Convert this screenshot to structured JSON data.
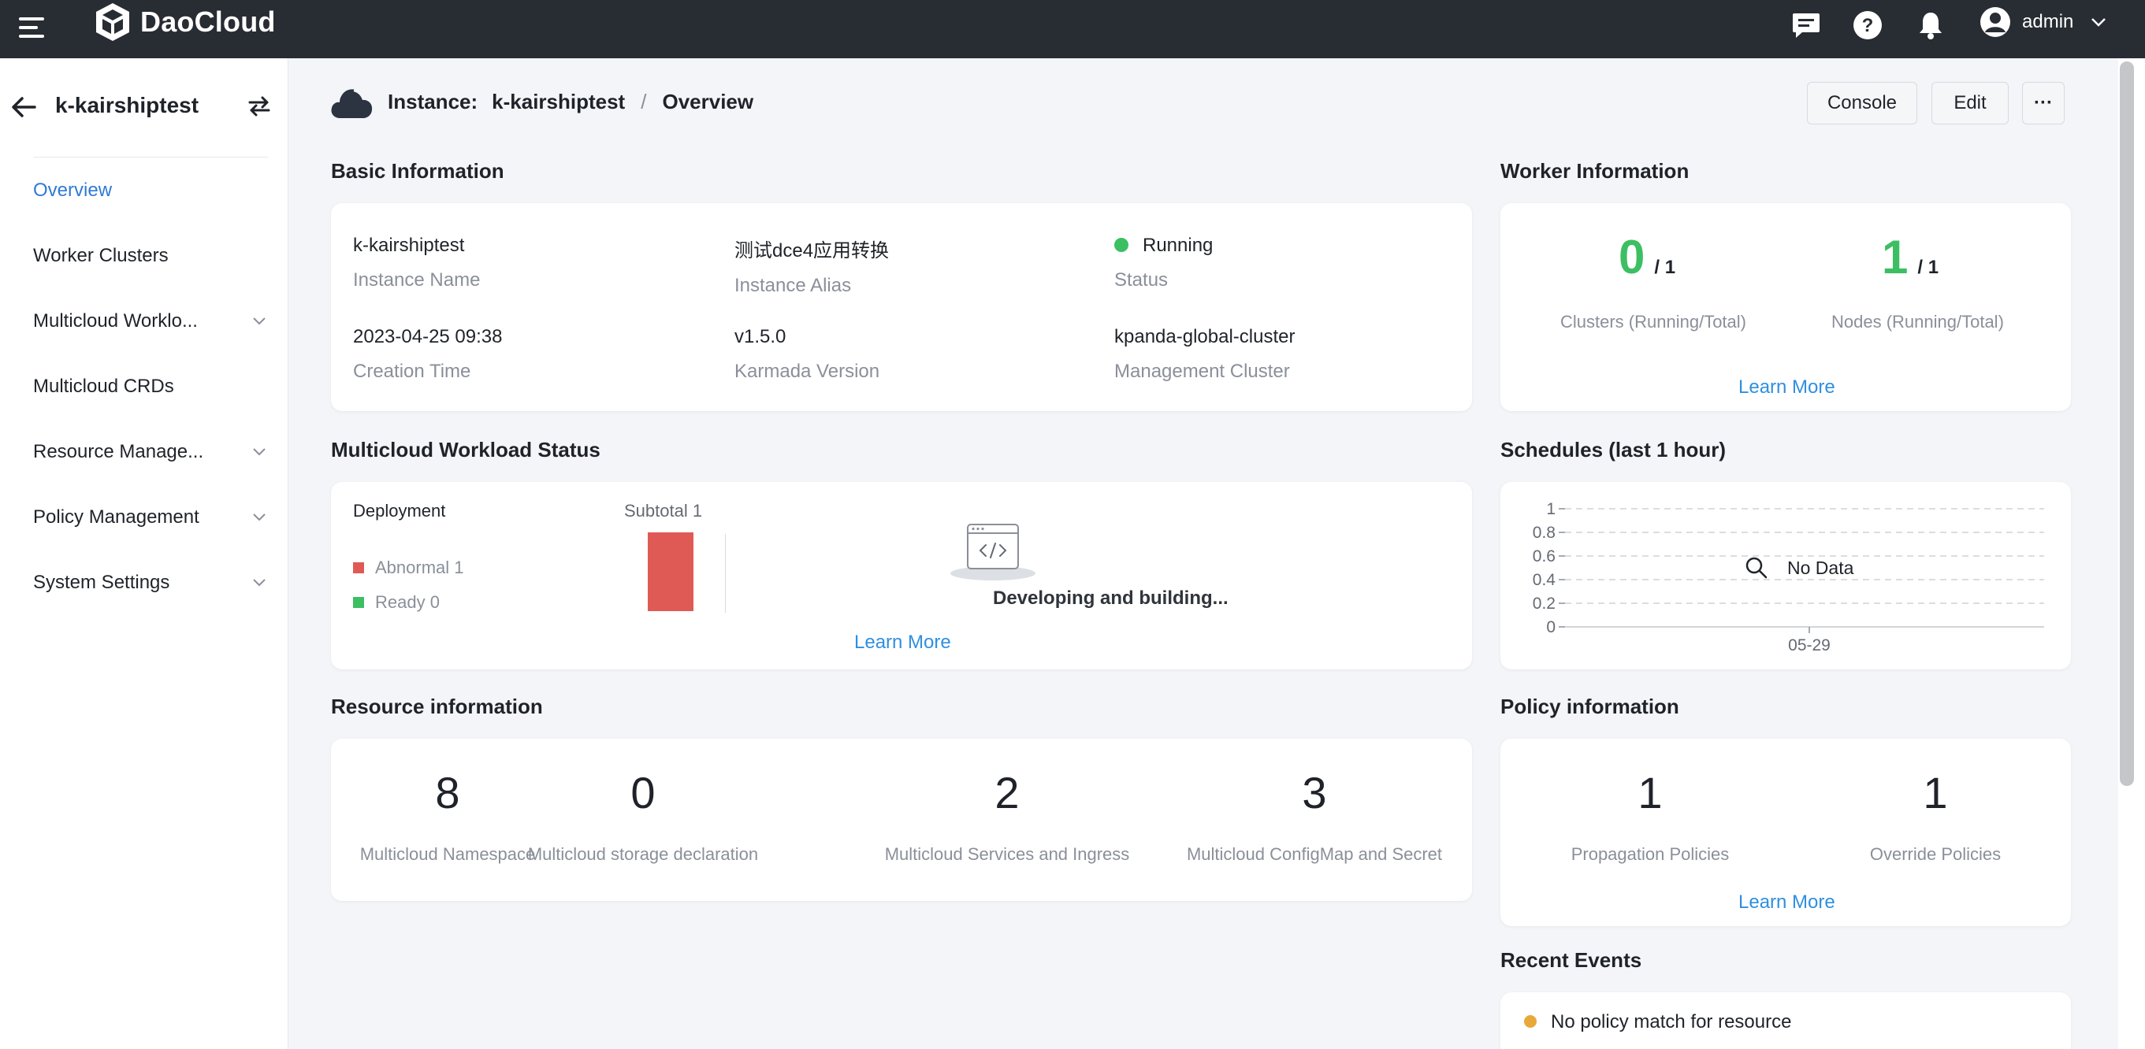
{
  "topbar": {
    "brand": "DaoCloud",
    "user": "admin"
  },
  "sidebar": {
    "title": "k-kairshiptest",
    "items": [
      {
        "label": "Overview",
        "active": true,
        "expandable": false
      },
      {
        "label": "Worker Clusters",
        "active": false,
        "expandable": false
      },
      {
        "label": "Multicloud Worklo...",
        "active": false,
        "expandable": true
      },
      {
        "label": "Multicloud CRDs",
        "active": false,
        "expandable": false
      },
      {
        "label": "Resource Manage...",
        "active": false,
        "expandable": true
      },
      {
        "label": "Policy Management",
        "active": false,
        "expandable": true
      },
      {
        "label": "System Settings",
        "active": false,
        "expandable": true
      }
    ]
  },
  "header": {
    "crumb_label": "Instance:",
    "crumb_name": "k-kairshiptest",
    "crumb_sep": "/",
    "crumb_current": "Overview",
    "buttons": {
      "console": "Console",
      "edit": "Edit",
      "more": "···"
    }
  },
  "basic_info": {
    "title": "Basic Information",
    "instance_name": {
      "value": "k-kairshiptest",
      "label": "Instance Name"
    },
    "instance_alias": {
      "value": "测试dce4应用转换",
      "label": "Instance Alias"
    },
    "status": {
      "value": "Running",
      "label": "Status",
      "color": "#3cbf62"
    },
    "creation_time": {
      "value": "2023-04-25 09:38",
      "label": "Creation Time"
    },
    "karmada_version": {
      "value": "v1.5.0",
      "label": "Karmada Version"
    },
    "management_cluster": {
      "value": "kpanda-global-cluster",
      "label": "Management Cluster"
    }
  },
  "worker_info": {
    "title": "Worker Information",
    "clusters": {
      "running": "0",
      "total": "/ 1",
      "label": "Clusters (Running/Total)"
    },
    "nodes": {
      "running": "1",
      "total": "/ 1",
      "label": "Nodes (Running/Total)"
    },
    "learn_more": "Learn More"
  },
  "workload_status": {
    "title": "Multicloud Workload Status",
    "kind": "Deployment",
    "subtotal": "Subtotal 1",
    "abnormal": {
      "label": "Abnormal 1",
      "value": 1,
      "color": "#e05a55"
    },
    "ready": {
      "label": "Ready 0",
      "value": 0,
      "color": "#3cbf62"
    },
    "placeholder": "Developing and building...",
    "learn_more": "Learn More"
  },
  "schedules": {
    "title": "Schedules (last 1 hour)",
    "no_data": "No Data"
  },
  "chart_data": {
    "type": "line",
    "title": "Schedules (last 1 hour)",
    "x": [
      "05-29"
    ],
    "series": [],
    "yticks": [
      "1",
      "0.8",
      "0.6",
      "0.4",
      "0.2",
      "0"
    ],
    "ylim": [
      0,
      1
    ],
    "grid": true,
    "empty_text": "No Data"
  },
  "resource_info": {
    "title": "Resource information",
    "items": [
      {
        "value": "8",
        "label": "Multicloud Namespace"
      },
      {
        "value": "0",
        "label": "Multicloud storage declaration"
      },
      {
        "value": "2",
        "label": "Multicloud Services and Ingress"
      },
      {
        "value": "3",
        "label": "Multicloud ConfigMap and Secret"
      }
    ]
  },
  "policy_info": {
    "title": "Policy information",
    "propagation": {
      "value": "1",
      "label": "Propagation Policies"
    },
    "override": {
      "value": "1",
      "label": "Override Policies"
    },
    "learn_more": "Learn More"
  },
  "recent_events": {
    "title": "Recent Events",
    "items": [
      {
        "text": "No policy match for resource",
        "color": "#e8a93a"
      }
    ]
  }
}
